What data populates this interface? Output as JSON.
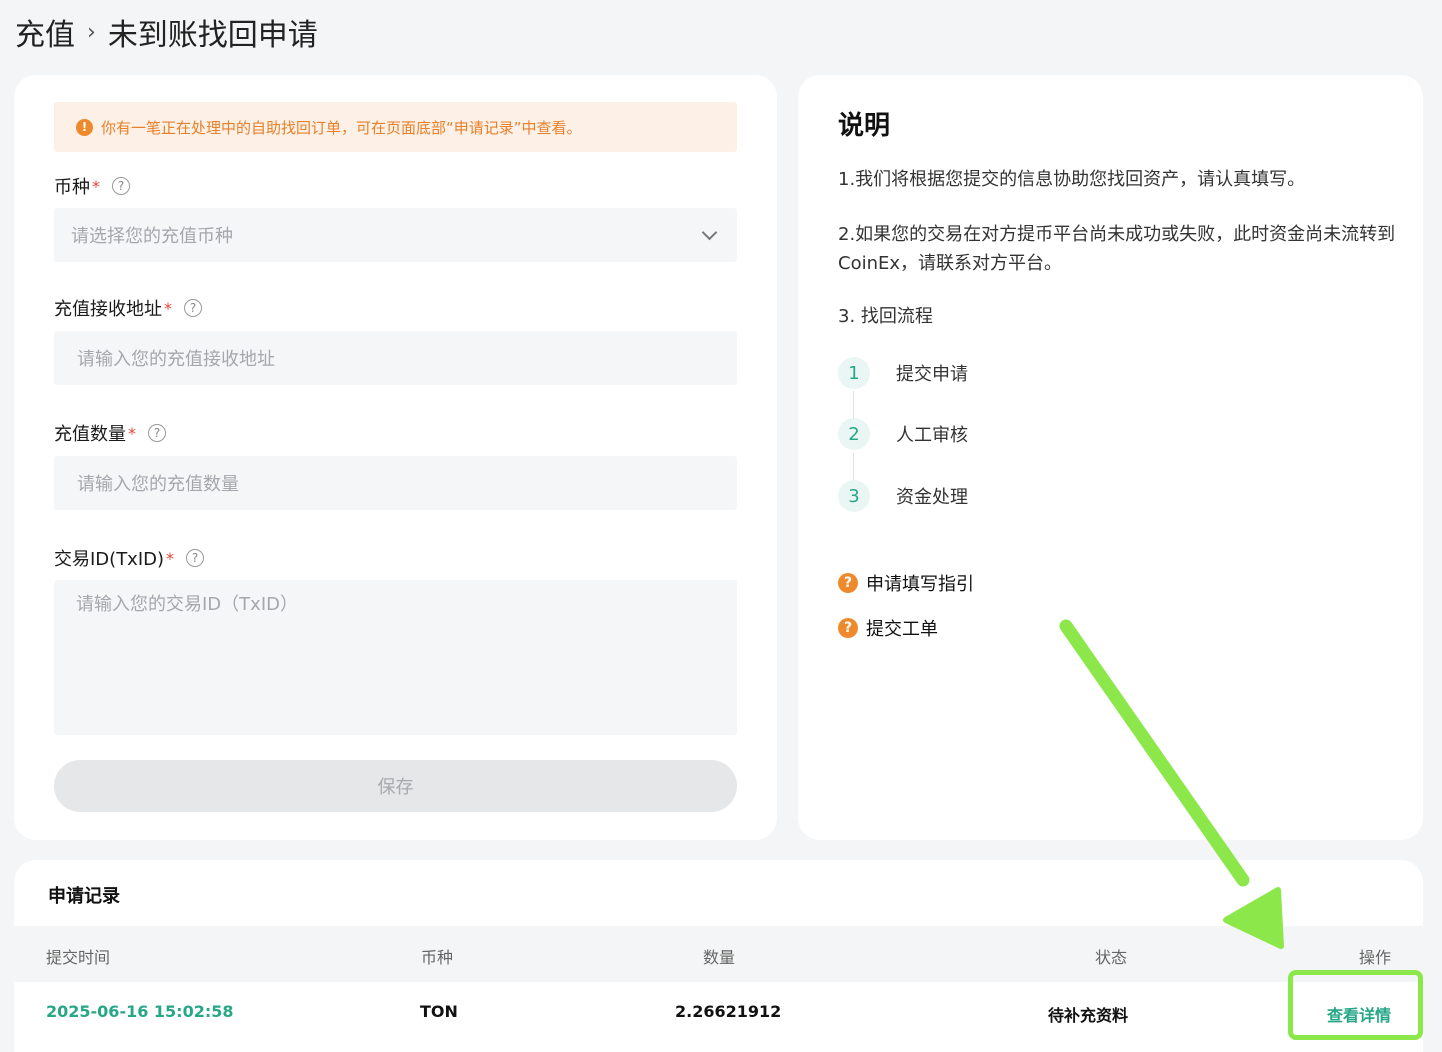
{
  "breadcrumb": {
    "root": "充值",
    "separator": "›",
    "current": "未到账找回申请"
  },
  "form": {
    "notice": "你有一笔正在处理中的自助找回订单，可在页面底部“申请记录”中查看。",
    "currency_label": "币种",
    "currency_placeholder": "请选择您的充值币种",
    "address_label": "充值接收地址",
    "address_placeholder": "请输入您的充值接收地址",
    "amount_label": "充值数量",
    "amount_placeholder": "请输入您的充值数量",
    "txid_label": "交易ID(TxID)",
    "txid_placeholder": "请输入您的交易ID（TxID）",
    "required_mark": "*",
    "help_mark": "?",
    "save_label": "保存"
  },
  "info": {
    "title": "说明",
    "p1": "1.我们将根据您提交的信息协助您找回资产，请认真填写。",
    "p2": "2.如果您的交易在对方提币平台尚未成功或失败，此时资金尚未流转到CoinEx，请联系对方平台。",
    "p3": "3. 找回流程",
    "steps": [
      {
        "num": "1",
        "label": "提交申请"
      },
      {
        "num": "2",
        "label": "人工审核"
      },
      {
        "num": "3",
        "label": "资金处理"
      }
    ],
    "links": [
      "申请填写指引",
      "提交工单"
    ]
  },
  "records": {
    "title": "申请记录",
    "headers": {
      "time": "提交时间",
      "coin": "币种",
      "amount": "数量",
      "status": "状态",
      "action": "操作"
    },
    "rows": [
      {
        "time": "2025-06-16 15:02:58",
        "coin": "TON",
        "amount": "2.26621912",
        "status": "待补充资料",
        "action": "查看详情"
      }
    ]
  },
  "colors": {
    "accent_green": "#27a787",
    "warning_orange": "#ef8a2c",
    "annotation_green": "#8ce84a"
  }
}
